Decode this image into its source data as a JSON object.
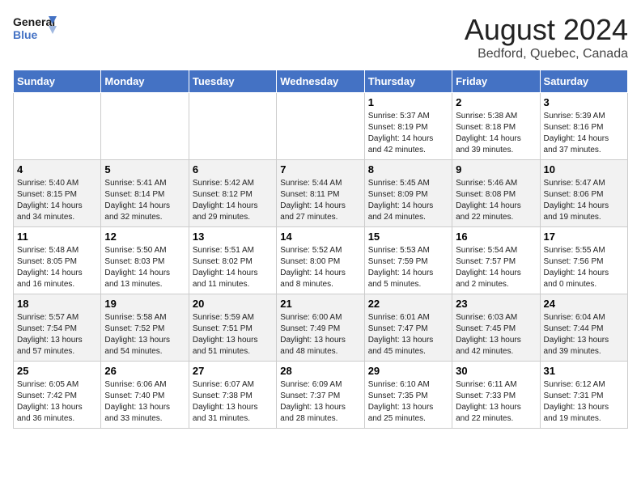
{
  "header": {
    "logo_line1": "General",
    "logo_line2": "Blue",
    "title": "August 2024",
    "subtitle": "Bedford, Quebec, Canada"
  },
  "weekdays": [
    "Sunday",
    "Monday",
    "Tuesday",
    "Wednesday",
    "Thursday",
    "Friday",
    "Saturday"
  ],
  "weeks": [
    [
      {
        "day": "",
        "detail": ""
      },
      {
        "day": "",
        "detail": ""
      },
      {
        "day": "",
        "detail": ""
      },
      {
        "day": "",
        "detail": ""
      },
      {
        "day": "1",
        "detail": "Sunrise: 5:37 AM\nSunset: 8:19 PM\nDaylight: 14 hours\nand 42 minutes."
      },
      {
        "day": "2",
        "detail": "Sunrise: 5:38 AM\nSunset: 8:18 PM\nDaylight: 14 hours\nand 39 minutes."
      },
      {
        "day": "3",
        "detail": "Sunrise: 5:39 AM\nSunset: 8:16 PM\nDaylight: 14 hours\nand 37 minutes."
      }
    ],
    [
      {
        "day": "4",
        "detail": "Sunrise: 5:40 AM\nSunset: 8:15 PM\nDaylight: 14 hours\nand 34 minutes."
      },
      {
        "day": "5",
        "detail": "Sunrise: 5:41 AM\nSunset: 8:14 PM\nDaylight: 14 hours\nand 32 minutes."
      },
      {
        "day": "6",
        "detail": "Sunrise: 5:42 AM\nSunset: 8:12 PM\nDaylight: 14 hours\nand 29 minutes."
      },
      {
        "day": "7",
        "detail": "Sunrise: 5:44 AM\nSunset: 8:11 PM\nDaylight: 14 hours\nand 27 minutes."
      },
      {
        "day": "8",
        "detail": "Sunrise: 5:45 AM\nSunset: 8:09 PM\nDaylight: 14 hours\nand 24 minutes."
      },
      {
        "day": "9",
        "detail": "Sunrise: 5:46 AM\nSunset: 8:08 PM\nDaylight: 14 hours\nand 22 minutes."
      },
      {
        "day": "10",
        "detail": "Sunrise: 5:47 AM\nSunset: 8:06 PM\nDaylight: 14 hours\nand 19 minutes."
      }
    ],
    [
      {
        "day": "11",
        "detail": "Sunrise: 5:48 AM\nSunset: 8:05 PM\nDaylight: 14 hours\nand 16 minutes."
      },
      {
        "day": "12",
        "detail": "Sunrise: 5:50 AM\nSunset: 8:03 PM\nDaylight: 14 hours\nand 13 minutes."
      },
      {
        "day": "13",
        "detail": "Sunrise: 5:51 AM\nSunset: 8:02 PM\nDaylight: 14 hours\nand 11 minutes."
      },
      {
        "day": "14",
        "detail": "Sunrise: 5:52 AM\nSunset: 8:00 PM\nDaylight: 14 hours\nand 8 minutes."
      },
      {
        "day": "15",
        "detail": "Sunrise: 5:53 AM\nSunset: 7:59 PM\nDaylight: 14 hours\nand 5 minutes."
      },
      {
        "day": "16",
        "detail": "Sunrise: 5:54 AM\nSunset: 7:57 PM\nDaylight: 14 hours\nand 2 minutes."
      },
      {
        "day": "17",
        "detail": "Sunrise: 5:55 AM\nSunset: 7:56 PM\nDaylight: 14 hours\nand 0 minutes."
      }
    ],
    [
      {
        "day": "18",
        "detail": "Sunrise: 5:57 AM\nSunset: 7:54 PM\nDaylight: 13 hours\nand 57 minutes."
      },
      {
        "day": "19",
        "detail": "Sunrise: 5:58 AM\nSunset: 7:52 PM\nDaylight: 13 hours\nand 54 minutes."
      },
      {
        "day": "20",
        "detail": "Sunrise: 5:59 AM\nSunset: 7:51 PM\nDaylight: 13 hours\nand 51 minutes."
      },
      {
        "day": "21",
        "detail": "Sunrise: 6:00 AM\nSunset: 7:49 PM\nDaylight: 13 hours\nand 48 minutes."
      },
      {
        "day": "22",
        "detail": "Sunrise: 6:01 AM\nSunset: 7:47 PM\nDaylight: 13 hours\nand 45 minutes."
      },
      {
        "day": "23",
        "detail": "Sunrise: 6:03 AM\nSunset: 7:45 PM\nDaylight: 13 hours\nand 42 minutes."
      },
      {
        "day": "24",
        "detail": "Sunrise: 6:04 AM\nSunset: 7:44 PM\nDaylight: 13 hours\nand 39 minutes."
      }
    ],
    [
      {
        "day": "25",
        "detail": "Sunrise: 6:05 AM\nSunset: 7:42 PM\nDaylight: 13 hours\nand 36 minutes."
      },
      {
        "day": "26",
        "detail": "Sunrise: 6:06 AM\nSunset: 7:40 PM\nDaylight: 13 hours\nand 33 minutes."
      },
      {
        "day": "27",
        "detail": "Sunrise: 6:07 AM\nSunset: 7:38 PM\nDaylight: 13 hours\nand 31 minutes."
      },
      {
        "day": "28",
        "detail": "Sunrise: 6:09 AM\nSunset: 7:37 PM\nDaylight: 13 hours\nand 28 minutes."
      },
      {
        "day": "29",
        "detail": "Sunrise: 6:10 AM\nSunset: 7:35 PM\nDaylight: 13 hours\nand 25 minutes."
      },
      {
        "day": "30",
        "detail": "Sunrise: 6:11 AM\nSunset: 7:33 PM\nDaylight: 13 hours\nand 22 minutes."
      },
      {
        "day": "31",
        "detail": "Sunrise: 6:12 AM\nSunset: 7:31 PM\nDaylight: 13 hours\nand 19 minutes."
      }
    ]
  ]
}
